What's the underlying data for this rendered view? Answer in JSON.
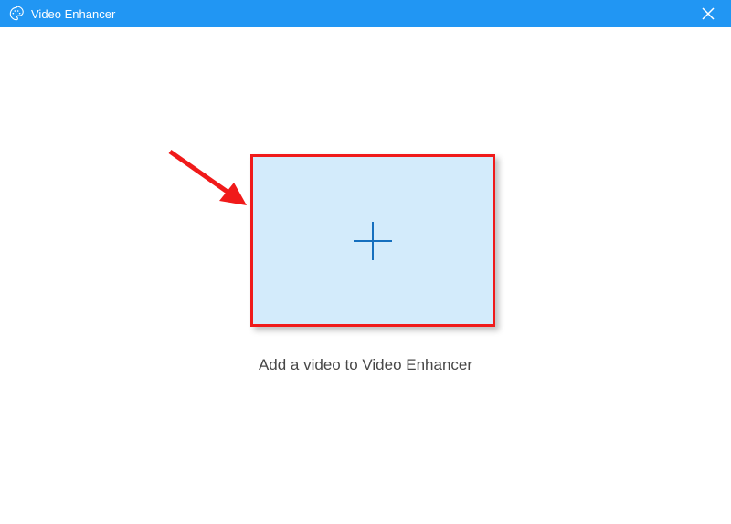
{
  "window": {
    "title": "Video Enhancer"
  },
  "main": {
    "caption": "Add a video to Video Enhancer"
  },
  "colors": {
    "titlebar_bg": "#2196f3",
    "dropzone_bg": "#d3ebfb",
    "highlight_border": "#f01a1a",
    "plus_stroke": "#156fbe",
    "arrow": "#f01a1a",
    "text": "#474747"
  },
  "icons": {
    "app": "palette-icon",
    "close": "close-icon",
    "add": "plus-icon"
  }
}
